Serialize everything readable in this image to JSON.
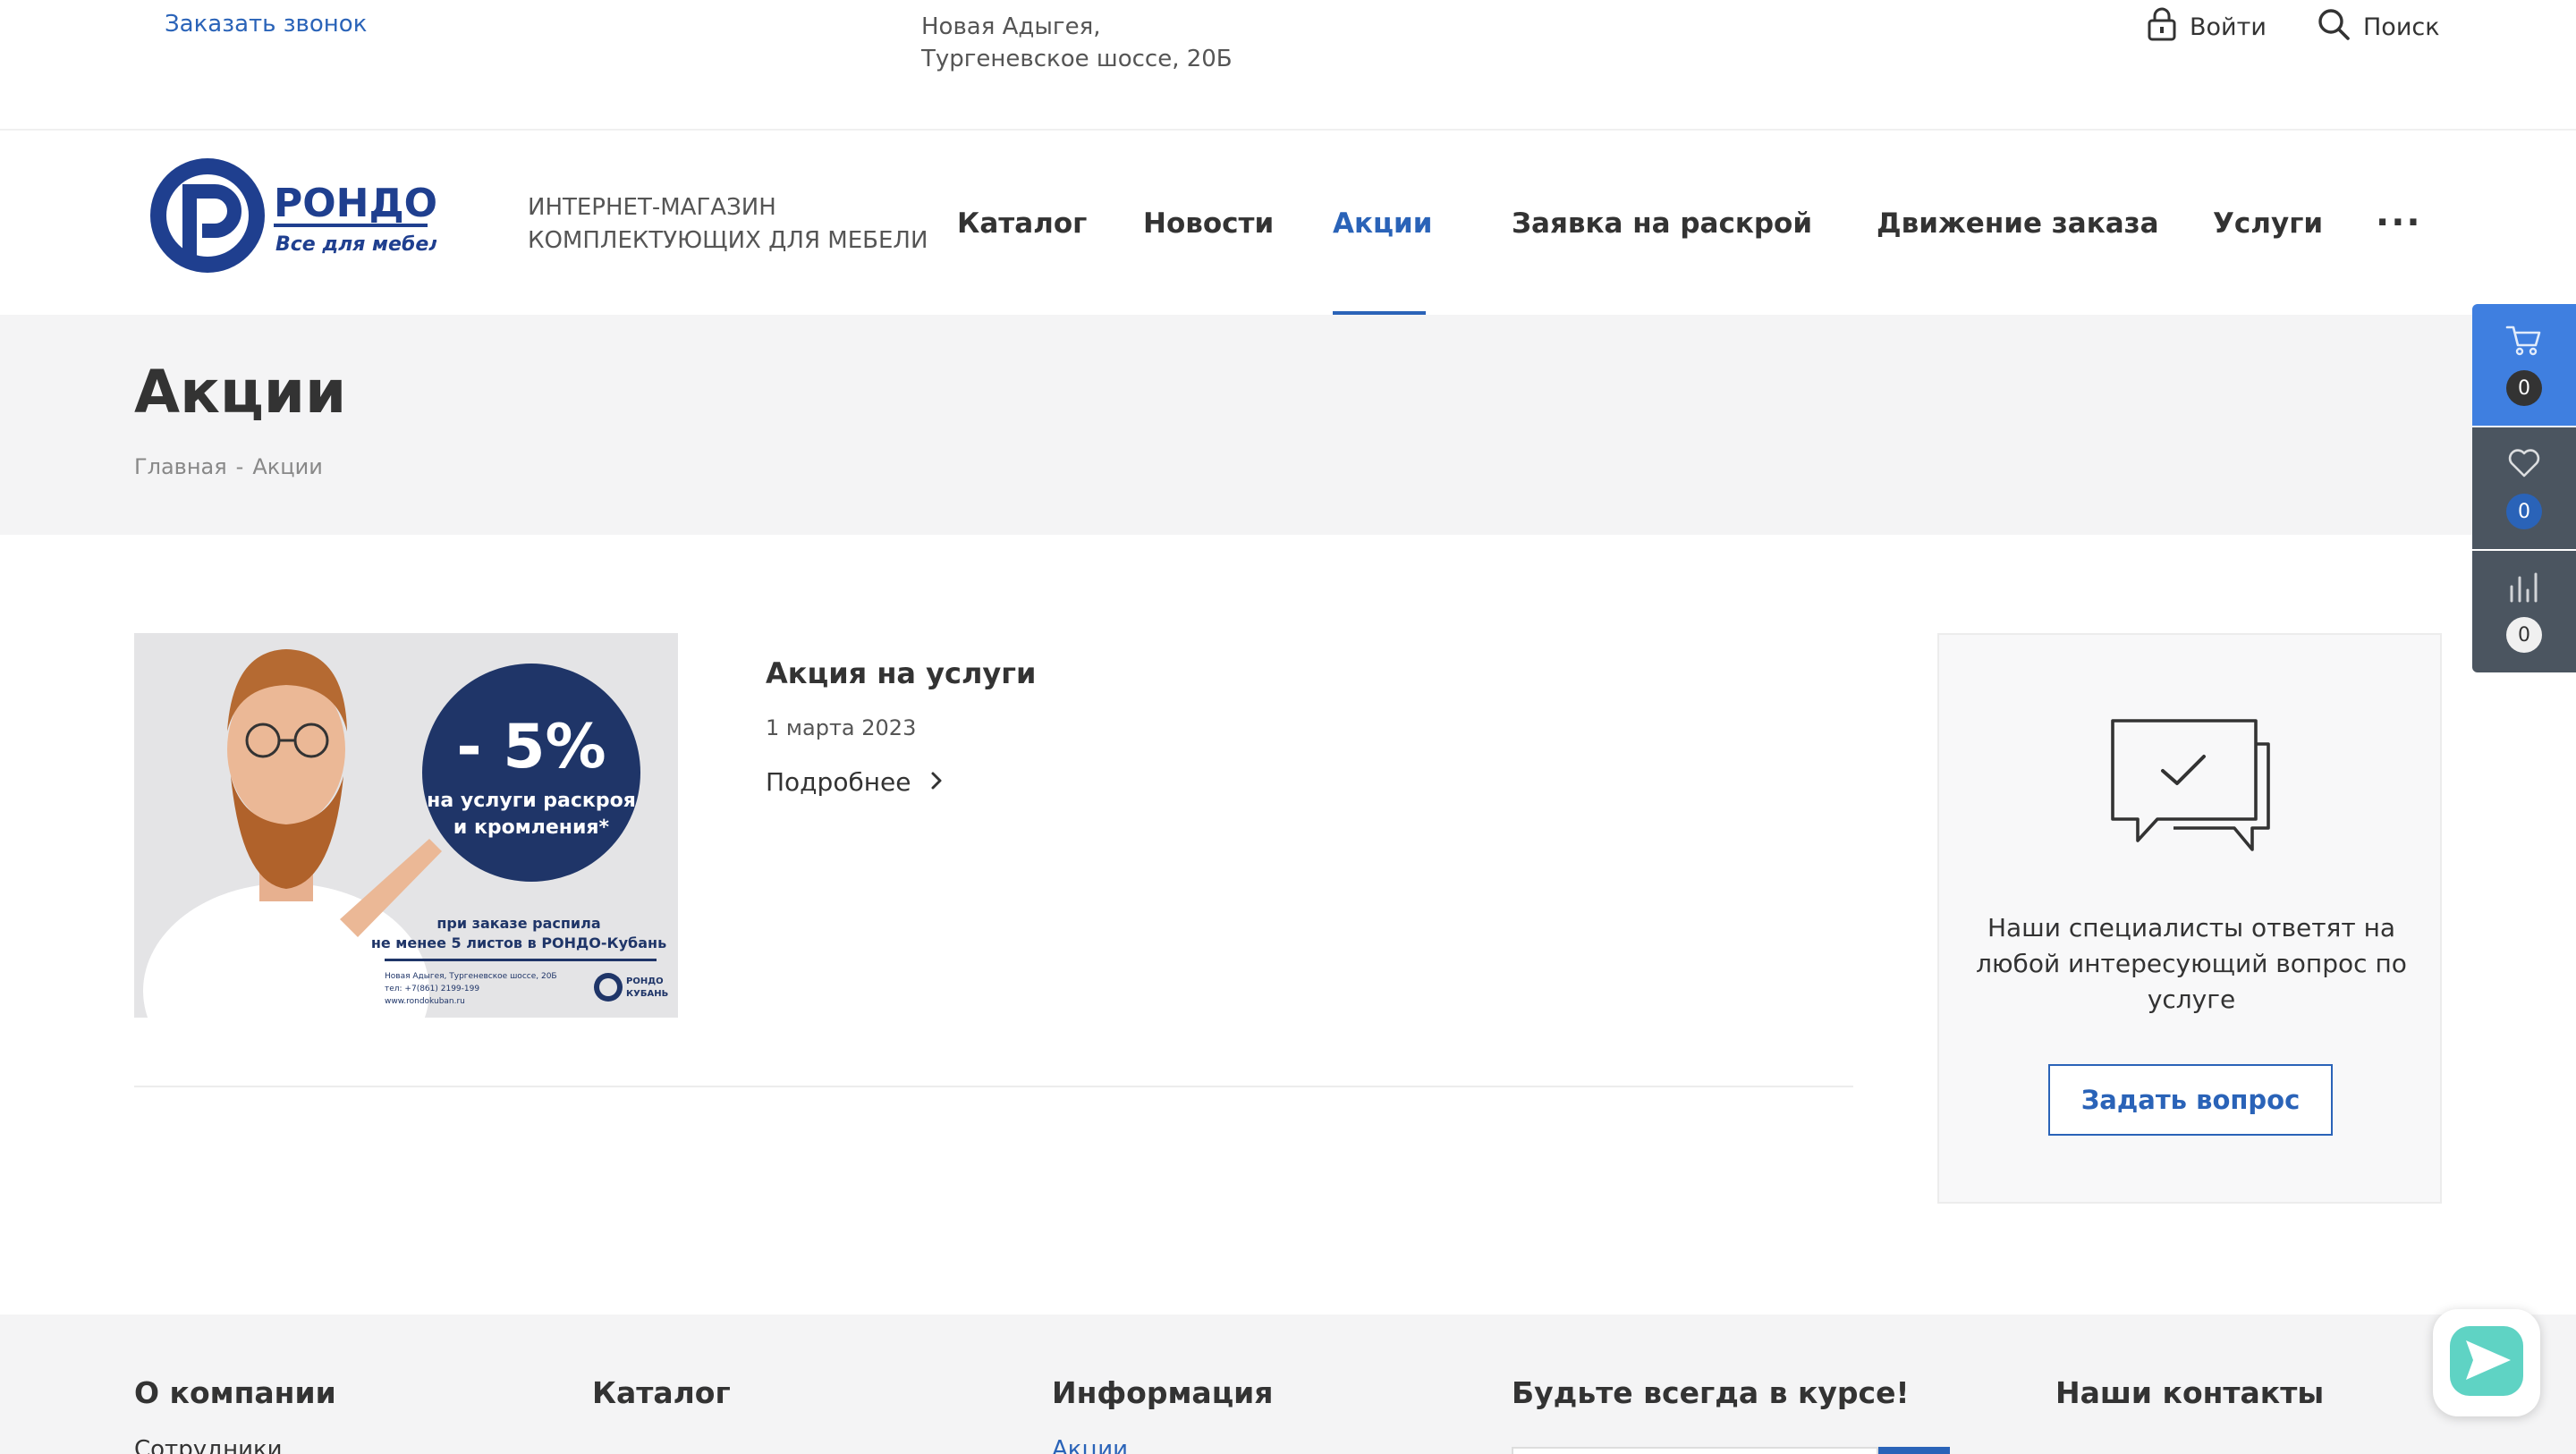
{
  "topbar": {
    "callback": "Заказать звонок",
    "address_line1": "Новая Адыгея,",
    "address_line2": "Тургеневское шоссе, 20Б",
    "login": "Войти",
    "search": "Поиск"
  },
  "header": {
    "logo_name": "РОНДО",
    "logo_slogan": "Все для мебели",
    "tagline_line1": "ИНТЕРНЕТ-МАГАЗИН",
    "tagline_line2": "КОМПЛЕКТУЮЩИХ ДЛЯ МЕБЕЛИ",
    "nav": [
      {
        "label": "Каталог"
      },
      {
        "label": "Новости"
      },
      {
        "label": "Акции",
        "active": true
      },
      {
        "label": "Заявка на раскрой"
      },
      {
        "label": "Движение заказа"
      },
      {
        "label": "Услуги"
      }
    ],
    "more": "···",
    "accent_color": "#2a63b8"
  },
  "page": {
    "title": "Акции",
    "breadcrumb": [
      "Главная",
      "-",
      "Акции"
    ]
  },
  "promo": {
    "image": {
      "discount": "- 5%",
      "line1": "на услуги раскроя",
      "line2": "и кромления*",
      "note1": "при заказе распила",
      "note2": "не менее 5 листов в РОНДО-Кубань",
      "contact1": "Новая Адыгея, Тургеневское шоссе, 20Б",
      "contact2": "тел: +7(861) 2199-199",
      "contact3": "www.rondokuban.ru",
      "brand1": "РОНДО",
      "brand2": "КУБАНЬ"
    },
    "title": "Акция на услуги",
    "date": "1 марта 2023",
    "more": "Подробнее"
  },
  "ask": {
    "text": "Наши специалисты ответят на любой интересующий вопрос по услуге",
    "button": "Задать вопрос"
  },
  "side_panel": {
    "cart_count": "0",
    "favorites_count": "0",
    "compare_count": "0"
  },
  "footer": {
    "col1": "О компании",
    "col2": "Каталог",
    "col3": "Информация",
    "col4": "Будьте всегда в курсе!",
    "col5": "Наши контакты",
    "link1": "Сотрудники",
    "link3": "Акции"
  }
}
